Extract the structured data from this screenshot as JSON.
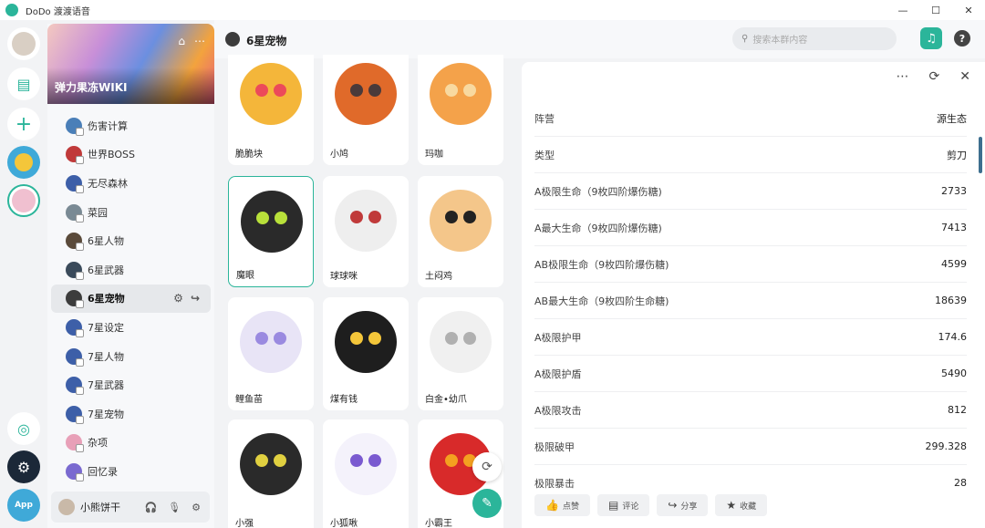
{
  "window": {
    "title": "DoDo 渡渡语音",
    "minimize": "—",
    "maximize": "☐",
    "close": "✕"
  },
  "server": {
    "name": "弹力果冻WIKI"
  },
  "channels": [
    {
      "label": "伤害计算",
      "color": "#4a7fb8"
    },
    {
      "label": "世界BOSS",
      "color": "#c03a3a"
    },
    {
      "label": "无尽森林",
      "color": "#3d5fa8"
    },
    {
      "label": "菜园",
      "color": "#7a8a94"
    },
    {
      "label": "6星人物",
      "color": "#5a4a3a"
    },
    {
      "label": "6星武器",
      "color": "#3a4a5a"
    },
    {
      "label": "6星宠物",
      "color": "#3c3c3c",
      "active": true
    },
    {
      "label": "7星设定",
      "color": "#3d5fa8"
    },
    {
      "label": "7星人物",
      "color": "#3d5fa8"
    },
    {
      "label": "7星武器",
      "color": "#3d5fa8"
    },
    {
      "label": "7星宠物",
      "color": "#3d5fa8"
    },
    {
      "label": "杂项",
      "color": "#e8a0b8"
    },
    {
      "label": "回忆录",
      "color": "#7a6ad0"
    }
  ],
  "user": {
    "name": "小熊饼干"
  },
  "header": {
    "channel": "6星宠物",
    "search_placeholder": "搜索本群内容",
    "help": "?"
  },
  "pets": [
    {
      "name": "脆脆块",
      "color": "#f4b63a",
      "accent": "#ec4a5a"
    },
    {
      "name": "小鸠",
      "color": "#e06a2a",
      "accent": "#4a3a3a"
    },
    {
      "name": "玛咖",
      "color": "#f4a24a",
      "accent": "#f8d9a0"
    },
    {
      "name": "魔眼",
      "color": "#2a2a2a",
      "accent": "#b8e03a",
      "selected": true
    },
    {
      "name": "球球咪",
      "color": "#eeeeee",
      "accent": "#c03a3a"
    },
    {
      "name": "土闷鸡",
      "color": "#f4c68a",
      "accent": "#222222"
    },
    {
      "name": "鲤鱼苗",
      "color": "#e8e4f6",
      "accent": "#9a8ae0"
    },
    {
      "name": "煤有钱",
      "color": "#1e1e1e",
      "accent": "#f4c63a"
    },
    {
      "name": "白金•幼爪",
      "color": "#f0f0f0",
      "accent": "#b0b0b0"
    },
    {
      "name": "小强",
      "color": "#2a2a2a",
      "accent": "#e0d040"
    },
    {
      "name": "小狐啾",
      "color": "#f4f2fb",
      "accent": "#7a5ad0"
    },
    {
      "name": "小霸王",
      "color": "#d82a2a",
      "accent": "#f4a020"
    }
  ],
  "details": [
    {
      "key": "阵营",
      "value": "源生态"
    },
    {
      "key": "类型",
      "value": "剪刀"
    },
    {
      "key": "A极限生命（9枚四阶爆伤糖)",
      "value": "2733"
    },
    {
      "key": "A最大生命（9枚四阶爆伤糖)",
      "value": "7413"
    },
    {
      "key": "AB极限生命（9枚四阶爆伤糖)",
      "value": "4599"
    },
    {
      "key": "AB最大生命（9枚四阶生命糖)",
      "value": "18639"
    },
    {
      "key": "A极限护甲",
      "value": "174.6"
    },
    {
      "key": "A极限护盾",
      "value": "5490"
    },
    {
      "key": "A极限攻击",
      "value": "812"
    },
    {
      "key": "极限破甲",
      "value": "299.328"
    },
    {
      "key": "极限暴击",
      "value": "28"
    }
  ],
  "panel_actions": [
    {
      "label": "点赞",
      "icon": "thumb-up-icon",
      "glyph": "👍"
    },
    {
      "label": "评论",
      "icon": "comment-icon",
      "glyph": "▤"
    },
    {
      "label": "分享",
      "icon": "share-icon",
      "glyph": "↪"
    },
    {
      "label": "收藏",
      "icon": "star-icon",
      "glyph": "★"
    }
  ]
}
